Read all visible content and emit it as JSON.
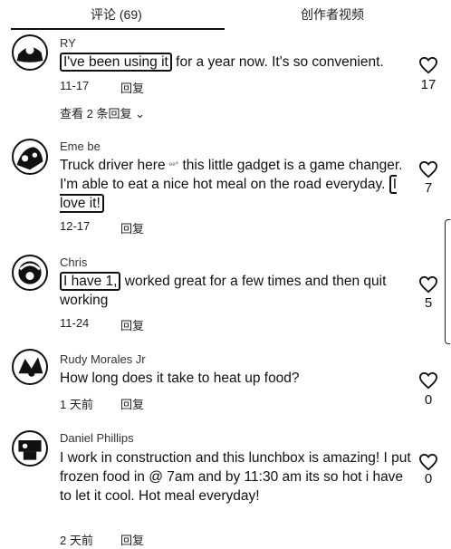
{
  "tabs": {
    "comments": "评论 (69)",
    "videos": "创作者视频"
  },
  "comments": [
    {
      "user": "RY",
      "text_hl": "I've been using it",
      "text_rest": " for a year now. It's so convenient.",
      "date": "11-17",
      "reply": "回复",
      "likes": "17",
      "view_replies": "查看 2 条回复 ⌄"
    },
    {
      "user": "Eme be",
      "text_pre": "Truck driver here ",
      "sticker": "ᵉᵉ°",
      "text_mid": " this little gadget is a game changer. I'm able to eat a nice hot meal on the road everyday. ",
      "text_hl": "I love it!",
      "date": "12-17",
      "reply": "回复",
      "likes": "7"
    },
    {
      "user": "Chris",
      "text_hl": "I have 1,",
      "text_rest": " worked great for a few times and then quit working",
      "date": "11-24",
      "reply": "回复",
      "likes": "5"
    },
    {
      "user": "Rudy Morales Jr",
      "text": "How long does it take to heat up food?",
      "date": "1 天前",
      "reply": "回复",
      "likes": "0"
    },
    {
      "user": "Daniel Phillips",
      "text": "I work in construction and this lunchbox is amazing! I put frozen food in @ 7am and by 11:30 am its so hot i have to let it cool. Hot meal everyday!",
      "date": "2 天前",
      "reply": "回复",
      "likes": "0"
    }
  ],
  "icons": {
    "like": "heart-outline-icon",
    "expand": "chevron-down-icon"
  }
}
